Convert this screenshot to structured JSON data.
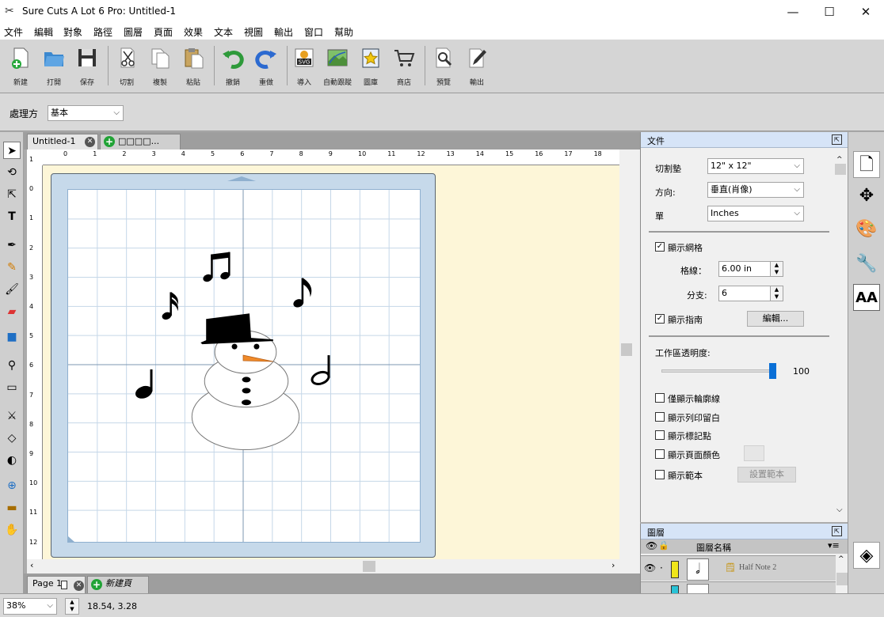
{
  "window": {
    "title": "Sure Cuts A Lot 6 Pro: Untitled-1",
    "minimize": "—",
    "maximize": "☐",
    "close": "✕"
  },
  "menu": [
    "文件",
    "編輯",
    "對象",
    "路徑",
    "圖層",
    "頁面",
    "效果",
    "文本",
    "視圖",
    "輸出",
    "窗口",
    "幫助"
  ],
  "toolbar": {
    "new": "新建",
    "open": "打開",
    "save": "保存",
    "cut": "切割",
    "copy": "複製",
    "paste": "粘貼",
    "undo": "撤銷",
    "redo": "重做",
    "import": "導入",
    "trace": "自動跟蹤",
    "library": "圖庫",
    "store": "商店",
    "preview": "預覽",
    "output": "輸出"
  },
  "options": {
    "processing_label": "處理方",
    "processing_value": "基本"
  },
  "doc_tabs": {
    "active": "Untitled-1",
    "new_tab": "□□□□..."
  },
  "rulers": {
    "h": [
      "0",
      "1",
      "2",
      "3",
      "4",
      "5",
      "6",
      "7",
      "8",
      "9",
      "10",
      "11",
      "12",
      "13",
      "14",
      "15",
      "16",
      "17",
      "18"
    ],
    "v": [
      "1",
      "0",
      "1",
      "2",
      "3",
      "4",
      "5",
      "6",
      "7",
      "8",
      "9",
      "10",
      "11",
      "12"
    ]
  },
  "page_tabs": {
    "active": "Page 1",
    "new_page": "新建頁面..."
  },
  "document_panel": {
    "title": "文件",
    "mat_label": "切割墊",
    "mat_value": "12\" x 12\"",
    "orientation_label": "方向:",
    "orientation_value": "垂直(肖像)",
    "units_label": "單",
    "units_value": "Inches",
    "show_grid": "顯示網格",
    "grid_line_label": "格線：",
    "grid_line_value": "6.00 in",
    "subdiv_label": "分支:",
    "subdiv_value": "6",
    "show_guides": "顯示指南",
    "edit_button": "編輯...",
    "workspace_opacity": "工作區透明度:",
    "opacity_value": "100",
    "opacity_fraction": 1.0,
    "outline_only": "僅顯示輪廓線",
    "show_print_margin": "顯示列印留白",
    "show_marks": "顯示標記點",
    "show_page_color": "顯示頁面顏色",
    "show_template": "顯示範本",
    "set_template": "設置範本"
  },
  "layers_panel": {
    "title": "圖層",
    "column": "圖層名稱",
    "row1": "Half Note 2"
  },
  "status": {
    "zoom": "38%",
    "coords": "18.54, 3.28"
  },
  "colors": {
    "panel_header": "#d6e4f7",
    "mat_blue": "#c6d9ea",
    "workspace": "#fdf6d8",
    "slider_thumb": "#0a6fd6",
    "carrot": "#f08a2a"
  }
}
